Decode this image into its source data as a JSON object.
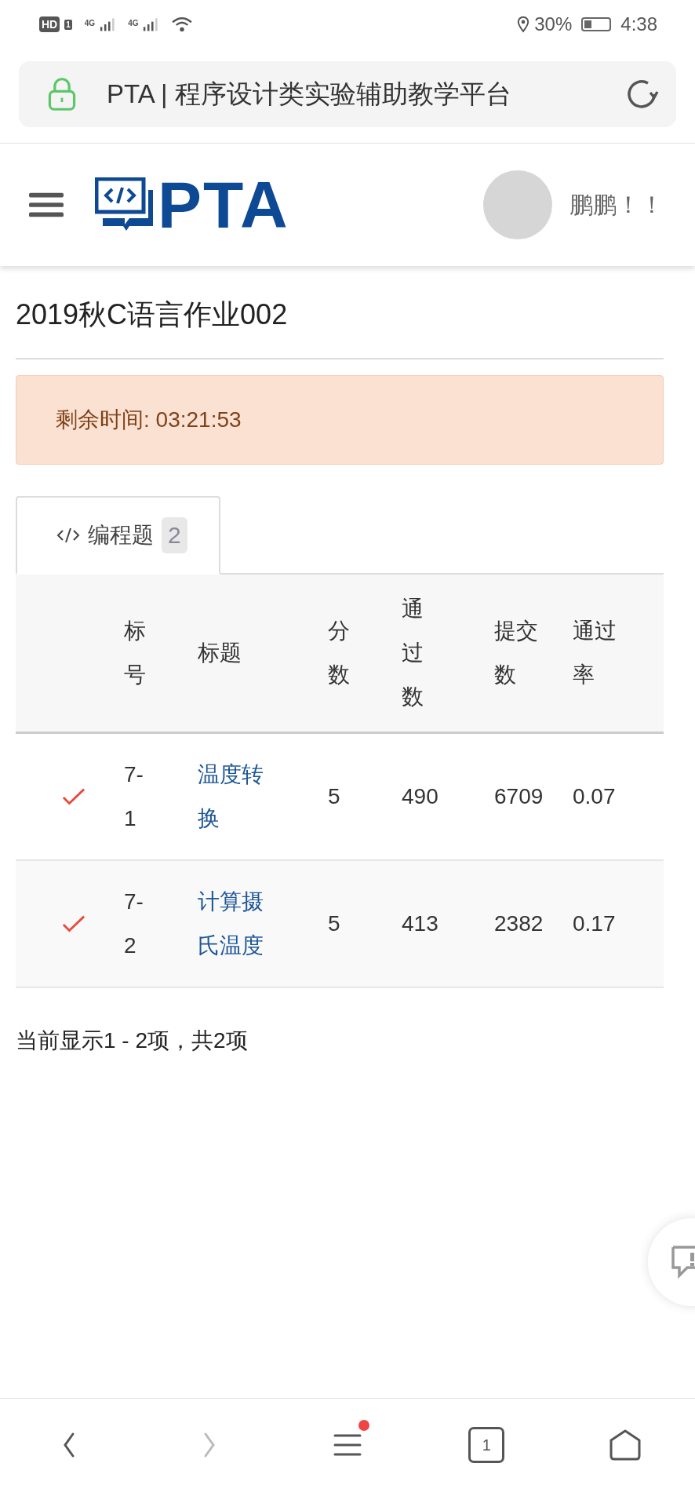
{
  "status_bar": {
    "hd_label": "HD",
    "sim_label": "1",
    "networks": [
      "4G",
      "4G"
    ],
    "battery_text": "30%",
    "time": "4:38"
  },
  "browser": {
    "url_title": "PTA | 程序设计类实验辅助教学平台"
  },
  "header": {
    "logo_text": "PTA",
    "user_name": "鹏鹏！！"
  },
  "page_title": "2019秋C语言作业002",
  "alert": {
    "text": "剩余时间: 03:21:53"
  },
  "tabs": [
    {
      "label": "编程题",
      "count": "2",
      "selected": true
    }
  ],
  "table": {
    "columns": [
      "",
      "标号",
      "标题",
      "分数",
      "通过数",
      "提交数",
      "通过率"
    ],
    "rows": [
      {
        "solved": true,
        "id": "7-1",
        "title": "温度转换",
        "score": "5",
        "passed": "490",
        "submitted": "6709",
        "rate": "0.07"
      },
      {
        "solved": true,
        "id": "7-2",
        "title": "计算摄氏温度",
        "score": "5",
        "passed": "413",
        "submitted": "2382",
        "rate": "0.17"
      }
    ]
  },
  "pagination_info": "当前显示1 - 2项，共2项",
  "bottom_nav": {
    "tab_count": "1",
    "menu_badge": true
  }
}
